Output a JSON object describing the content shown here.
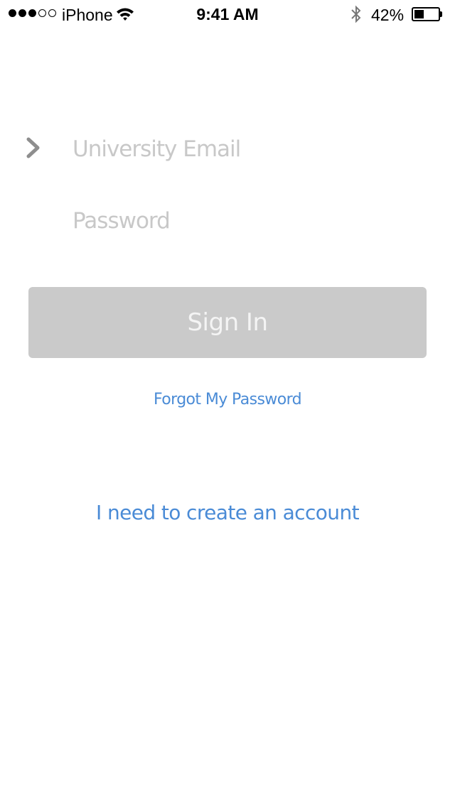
{
  "status_bar": {
    "signal_bars_filled": 3,
    "signal_bars_total": 5,
    "carrier": "iPhone",
    "wifi_icon": "wifi-icon",
    "time": "9:41 AM",
    "bluetooth_icon": "bluetooth-icon",
    "battery_percent_label": "42%",
    "battery_level": 0.42
  },
  "login_form": {
    "email_field": {
      "placeholder": "University Email",
      "value": "",
      "indicator_icon": "chevron-right-icon"
    },
    "password_field": {
      "placeholder": "Password",
      "value": ""
    },
    "sign_in_label": "Sign In",
    "forgot_password_label": "Forgot My Password",
    "create_account_label": "I need to create an account"
  },
  "colors": {
    "link": "#4a8bd6",
    "button_disabled": "#cacaca",
    "placeholder": "#c8c8c8",
    "chevron": "#8e8e8e"
  }
}
